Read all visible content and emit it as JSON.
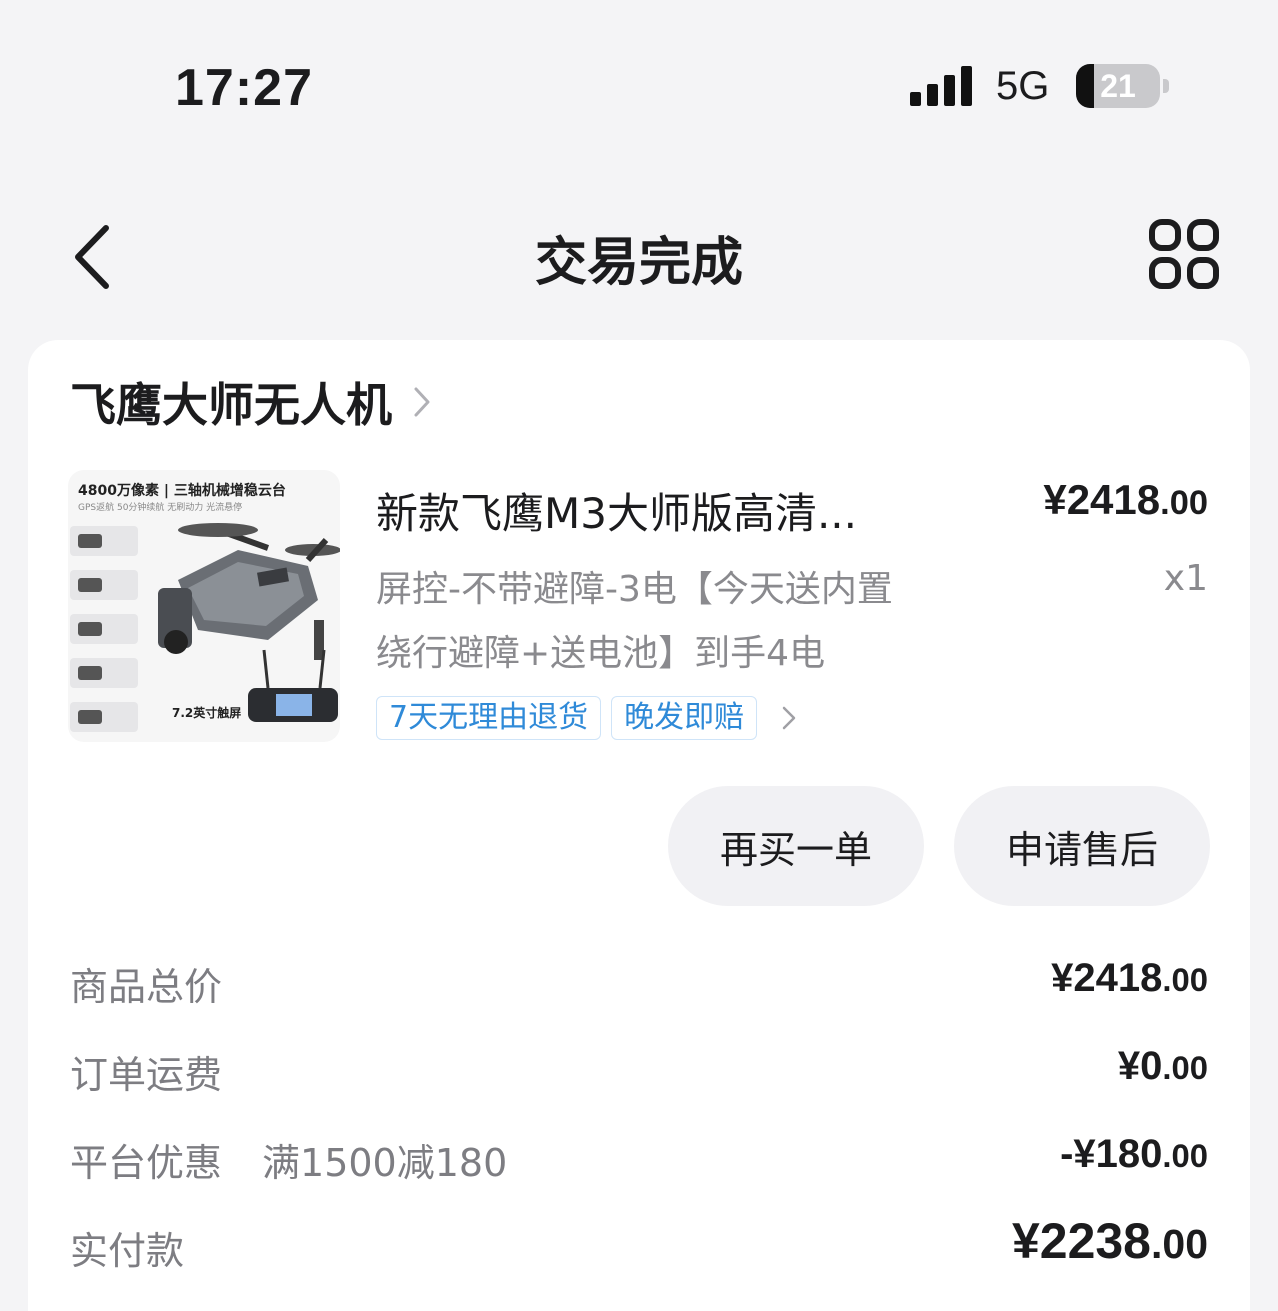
{
  "status_bar": {
    "time": "17:27",
    "network": "5G",
    "battery": "21"
  },
  "nav": {
    "title": "交易完成",
    "back_icon": "chevron-left-icon",
    "more_icon": "grid-four-icon"
  },
  "shop": {
    "name": "飞鹰大师无人机"
  },
  "product": {
    "image_headline": "4800万像素 | 三轴机械增稳云台",
    "image_subline": "GPS返航 50分钟续航 无刷动力 光流悬停",
    "image_caption": "7.2英寸触屏",
    "title": "新款飞鹰M3大师版高清...",
    "price_main": "¥2418",
    "price_cents": ".00",
    "spec_line1": "屏控-不带避障-3电【今天送内置",
    "spec_line2": "绕行避障+送电池】到手4电",
    "quantity": "x1",
    "tags": [
      "7天无理由退货",
      "晚发即赔"
    ]
  },
  "actions": {
    "rebuy": "再买一单",
    "after_sale": "申请售后"
  },
  "summary": {
    "goods_total_label": "商品总价",
    "goods_total_main": "¥2418",
    "goods_total_cents": ".00",
    "shipping_label": "订单运费",
    "shipping_main": "¥0",
    "shipping_cents": ".00",
    "discount_label": "平台优惠",
    "discount_detail": "满1500减180",
    "discount_main": "-¥180",
    "discount_cents": ".00",
    "paid_label": "实付款",
    "paid_main": "¥2238",
    "paid_cents": ".00"
  },
  "colors": {
    "tag_text": "#2f8ad8",
    "tag_border": "#cfe4f8",
    "muted_text": "#8a8a8e",
    "page_bg": "#f4f4f6"
  }
}
